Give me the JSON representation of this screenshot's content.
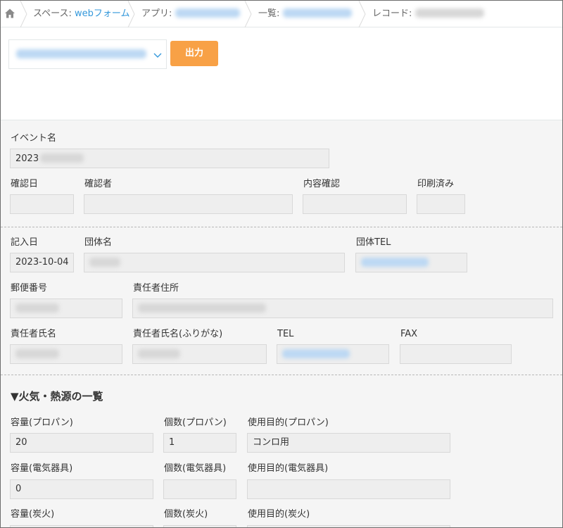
{
  "breadcrumb": {
    "space_prefix": "スペース: ",
    "space_name": "webフォーム",
    "app_prefix": "アプリ: ",
    "list_prefix": "一覧: ",
    "record_prefix": "レコード: "
  },
  "toolbar": {
    "output_label": "出力"
  },
  "record": {
    "event_name_label": "イベント名",
    "event_name_value": "2023",
    "confirm_date_label": "確認日",
    "confirmer_label": "確認者",
    "content_check_label": "内容確認",
    "printed_label": "印刷済み",
    "entry_date_label": "記入日",
    "entry_date_value": "2023-10-04",
    "org_name_label": "団体名",
    "org_tel_label": "団体TEL",
    "postal_label": "郵便番号",
    "address_label": "責任者住所",
    "person_label": "責任者氏名",
    "person_kana_label": "責任者氏名(ふりがな)",
    "tel_label": "TEL",
    "fax_label": "FAX"
  },
  "fire_section": {
    "title": "▼火気・熱源の一覧",
    "propane_capacity_label": "容量(プロパン)",
    "propane_capacity_value": "20",
    "propane_count_label": "個数(プロパン)",
    "propane_count_value": "1",
    "propane_purpose_label": "使用目的(プロパン)",
    "propane_purpose_value": "コンロ用",
    "electric_capacity_label": "容量(電気器具)",
    "electric_capacity_value": "0",
    "electric_count_label": "個数(電気器具)",
    "electric_purpose_label": "使用目的(電気器具)",
    "charcoal_capacity_label": "容量(炭火)",
    "charcoal_count_label": "個数(炭火)",
    "charcoal_purpose_label": "使用目的(炭火)"
  },
  "colors": {
    "accent_button": "#f8a146",
    "link": "#3498db",
    "field_bg": "#eeeeee",
    "content_bg": "#f5f5f5"
  },
  "icons": {
    "home": "home-icon",
    "chevron": "chevron-down-icon",
    "separator": "breadcrumb-separator-icon"
  }
}
